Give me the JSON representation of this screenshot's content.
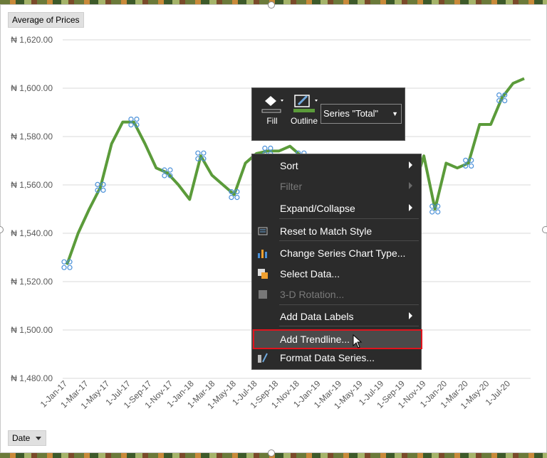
{
  "field_buttons": {
    "values_label": "Average of Prices",
    "axis_label": "Date"
  },
  "chart_data": {
    "type": "line",
    "title": "",
    "ylim": [
      1480,
      1620
    ],
    "y_ticks": [
      "₦ 1,620.00",
      "₦ 1,600.00",
      "₦ 1,580.00",
      "₦ 1,560.00",
      "₦ 1,540.00",
      "₦ 1,520.00",
      "₦ 1,500.00",
      "₦ 1,480.00"
    ],
    "x_tick_labels": [
      "1-Jan-17",
      "1-Mar-17",
      "1-May-17",
      "1-Jul-17",
      "1-Sep-17",
      "1-Nov-17",
      "1-Jan-18",
      "1-Mar-18",
      "1-May-18",
      "1-Jul-18",
      "1-Sep-18",
      "1-Nov-18",
      "1-Jan-19",
      "1-Mar-19",
      "1-May-19",
      "1-Jul-19",
      "1-Sep-19",
      "1-Nov-19",
      "1-Jan-20",
      "1-Mar-20",
      "1-May-20",
      "1-Jul-20"
    ],
    "series": [
      {
        "color": "#5b9b3a",
        "values": [
          1527,
          1540,
          1550,
          1559,
          1577,
          1586,
          1586,
          1577,
          1567,
          1565,
          1560,
          1554,
          1572,
          1564,
          1560,
          1556,
          1569,
          1573,
          1574,
          1574,
          1576,
          1572,
          1565,
          1563,
          1560,
          1561,
          1558,
          1556,
          1555,
          1557,
          1556,
          1557,
          1572,
          1550,
          1569,
          1567,
          1569,
          1585,
          1585,
          1596,
          1602,
          1604
        ]
      }
    ]
  },
  "mini_toolbar": {
    "fill_label": "Fill",
    "outline_label": "Outline",
    "series_selector": "Series \"Total\""
  },
  "context_menu": {
    "items": [
      {
        "label": "Sort",
        "icon": "",
        "submenu": true,
        "enabled": true
      },
      {
        "label": "Filter",
        "icon": "",
        "submenu": true,
        "enabled": false
      },
      {
        "label": "Expand/Collapse",
        "icon": "",
        "submenu": true,
        "enabled": true
      },
      {
        "label": "Reset to Match Style",
        "icon": "reset-style-icon",
        "submenu": false,
        "enabled": true
      },
      {
        "label": "Change Series Chart Type...",
        "icon": "bar-chart-icon",
        "submenu": false,
        "enabled": true
      },
      {
        "label": "Select Data...",
        "icon": "select-data-icon",
        "submenu": false,
        "enabled": true
      },
      {
        "label": "3-D Rotation...",
        "icon": "cube-icon",
        "submenu": false,
        "enabled": false
      },
      {
        "label": "Add Data Labels",
        "icon": "",
        "submenu": true,
        "enabled": true
      },
      {
        "label": "Add Trendline...",
        "icon": "",
        "submenu": false,
        "enabled": true,
        "hovered": true
      },
      {
        "label": "Format Data Series...",
        "icon": "format-series-icon",
        "submenu": false,
        "enabled": true
      }
    ]
  }
}
